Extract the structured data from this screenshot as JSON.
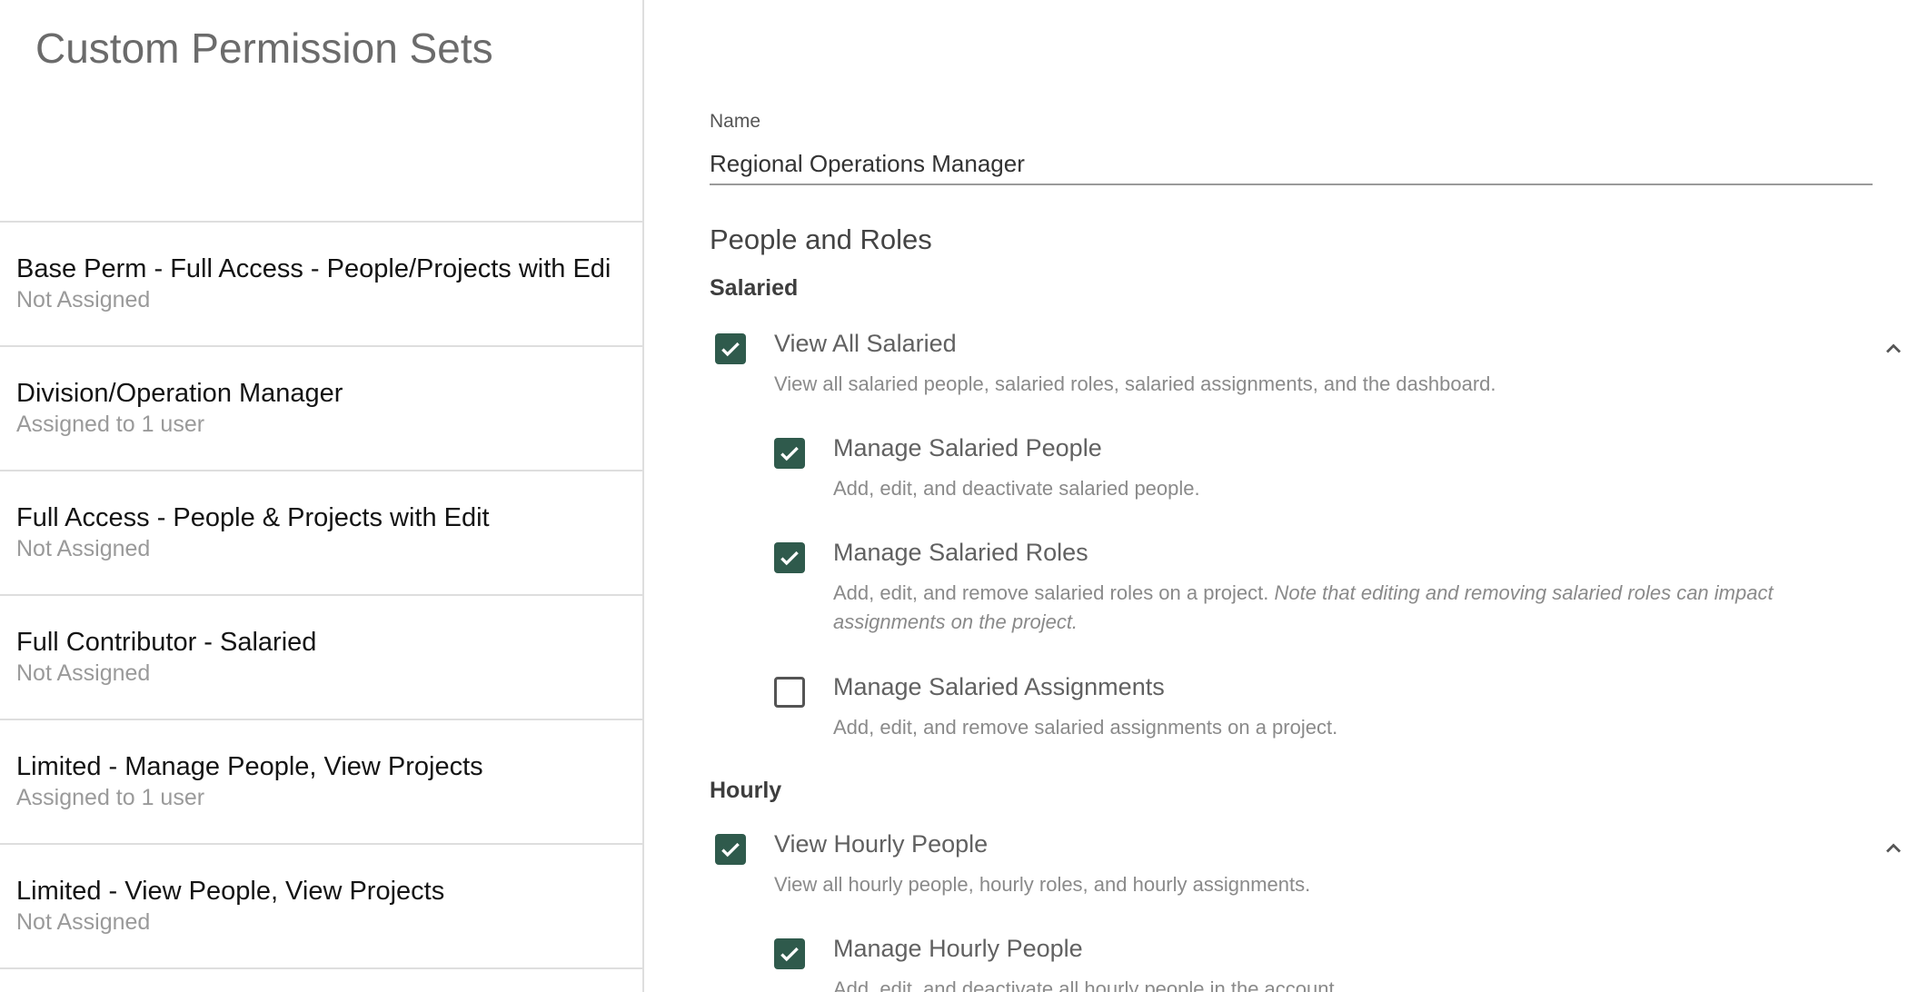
{
  "sidebar": {
    "title": "Custom Permission Sets",
    "items": [
      {
        "name": "Base Perm - Full Access - People/Projects with Edi",
        "status": "Not Assigned"
      },
      {
        "name": "Division/Operation Manager",
        "status": "Assigned to 1 user"
      },
      {
        "name": "Full Access - People & Projects with Edit",
        "status": "Not Assigned"
      },
      {
        "name": "Full Contributor - Salaried",
        "status": "Not Assigned"
      },
      {
        "name": "Limited - Manage People, View Projects",
        "status": "Assigned to 1 user"
      },
      {
        "name": "Limited - View People, View Projects",
        "status": "Not Assigned"
      }
    ]
  },
  "form": {
    "name_label": "Name",
    "name_value": "Regional Operations Manager",
    "section_title": "People and Roles"
  },
  "salaried": {
    "title": "Salaried",
    "view_all": {
      "label": "View All Salaried",
      "desc": "View all salaried people, salaried roles, salaried assignments, and the dashboard.",
      "checked": true
    },
    "manage_people": {
      "label": "Manage Salaried People",
      "desc": "Add, edit, and deactivate salaried people.",
      "checked": true
    },
    "manage_roles": {
      "label": "Manage Salaried Roles",
      "desc": "Add, edit, and remove salaried roles on a project. ",
      "note": "Note that editing and removing salaried roles can impact assignments on the project.",
      "checked": true
    },
    "manage_assignments": {
      "label": "Manage Salaried Assignments",
      "desc": "Add, edit, and remove salaried assignments on a project.",
      "checked": false
    }
  },
  "hourly": {
    "title": "Hourly",
    "view_people": {
      "label": "View Hourly People",
      "desc": "View all hourly people, hourly roles, and hourly assignments.",
      "checked": true
    },
    "manage_people": {
      "label": "Manage Hourly People",
      "desc": "Add, edit, and deactivate all hourly people in the account.",
      "checked": true
    }
  },
  "icons": {
    "checkbox_color": "#2f5a4c",
    "checkmark": "check-icon",
    "expand": "chevron-up-icon"
  }
}
